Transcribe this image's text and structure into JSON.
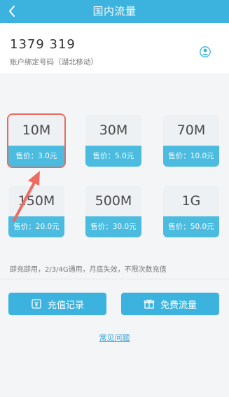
{
  "header": {
    "title": "国内流量",
    "back_icon": "chevron-left-icon"
  },
  "account": {
    "phone": "1379   319",
    "note": "账户绑定号码（湖北移动）",
    "user_icon": "user-icon"
  },
  "packages": [
    {
      "size": "10M",
      "price": "售价：3.0元",
      "selected": true
    },
    {
      "size": "30M",
      "price": "售价：5.0元",
      "selected": false
    },
    {
      "size": "70M",
      "price": "售价：10.0元",
      "selected": false
    },
    {
      "size": "150M",
      "price": "售价：20.0元",
      "selected": false
    },
    {
      "size": "500M",
      "price": "售价：30.0元",
      "selected": false
    },
    {
      "size": "1G",
      "price": "售价：50.0元",
      "selected": false
    }
  ],
  "note": "即充即用，2/3/4G通用，月底失效，不限次数充值",
  "buttons": {
    "recharge_record": "充值记录",
    "free_flow": "免费流量"
  },
  "faq": "常见问题",
  "colors": {
    "primary": "#3bb3de",
    "price_bg": "#4bbbe0",
    "highlight": "#e96a61"
  }
}
